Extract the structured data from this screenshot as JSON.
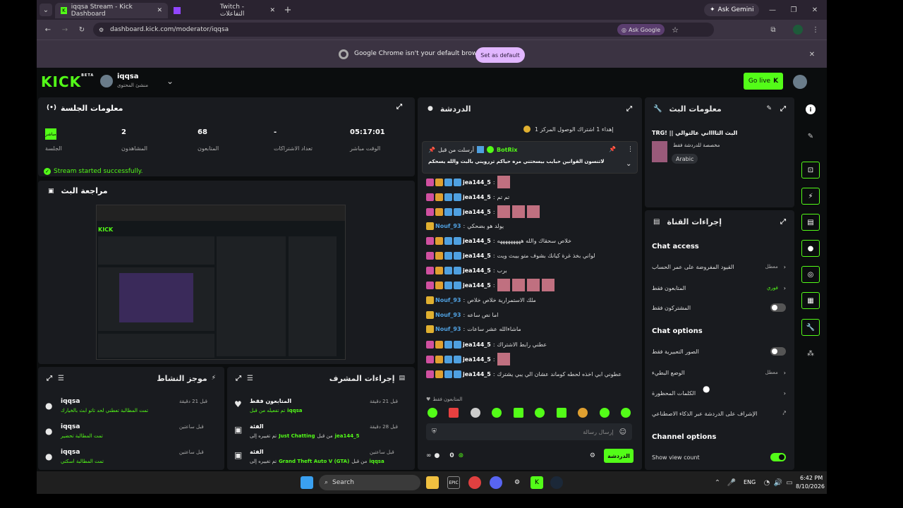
{
  "browser": {
    "tab1": "iqqsa Stream - Kick Dashboard",
    "tab2": "Twitch - التفاعلات",
    "ask_gemini": "Ask Gemini",
    "url": "dashboard.kick.com/moderator/iqqsa",
    "ask_google": "Ask Google"
  },
  "infobar": {
    "message": "Google Chrome isn't your default browser",
    "button": "Set as default"
  },
  "header": {
    "logo": "KICK",
    "beta": "BETA",
    "channel": "iqqsa",
    "role": "منشئ المحتوى",
    "go_live": "Go live"
  },
  "session": {
    "title": "معلومات الجلسة",
    "live": "مباشر",
    "session_label": "الجلسة",
    "viewers": "2",
    "viewers_label": "المشاهدون",
    "followers": "68",
    "followers_label": "المتابعون",
    "subs": "-",
    "subs_label": "تعداد الاشتراكات",
    "time": "05:17:01",
    "time_label": "الوقت مباشر",
    "status": "Stream started successfully."
  },
  "review": {
    "title": "مراجعة البث"
  },
  "activity": {
    "title": "موجز النشاط",
    "items": [
      {
        "user": "iqqsa",
        "time": "قبل 21 دقيقة",
        "text": "تمت المطالبة تعطني لحد تاتو ابث بالخيارك"
      },
      {
        "user": "iqqsa",
        "time": "قبل ساعتين",
        "text": "تمت المطالبة تحضير"
      },
      {
        "user": "iqqsa",
        "time": "قبل ساعتين",
        "text": "تمت المطالبة اسكتي"
      }
    ]
  },
  "modactions": {
    "title": "إجراءات المشرف",
    "items": [
      {
        "title": "المتابعون فقط",
        "time": "قبل 21 دقيقة",
        "text": "تم تفعيله من قبل",
        "user": "iqqsa"
      },
      {
        "title": "الفئة",
        "time": "قبل 28 دقيقة",
        "text": "تم تغييره إلى",
        "cat": "Just Chatting",
        "by": "من قبل",
        "user": "jea144_5"
      },
      {
        "title": "الفئة",
        "time": "قبل ساعتين",
        "text": "تم تغييره إلى",
        "cat": "Grand Theft Auto V (GTA)",
        "by": "من قبل",
        "user": "iqqsa"
      }
    ]
  },
  "chat": {
    "title": "الدردشة",
    "top_banner": "إهداء 1 اشتراك الوصول المركز 1",
    "pinned_by": "أرسلت من قبل",
    "pinned_user": "BotRix",
    "pinned_text": "لاتنسون القوانين حبايب بيسحتني مره حياكم تررويني بالبث والله يسحكم",
    "followers_only": "المتابعون فقط",
    "placeholder": "إرسال رسالة",
    "send": "الدردشة",
    "counter": "0",
    "lines": [
      {
        "user": "jea144_5",
        "text": ""
      },
      {
        "user": "jea144_5",
        "text": "تم تم"
      },
      {
        "user": "jea144_5",
        "text": ""
      },
      {
        "user": "Nouf_93",
        "text": "يولد هو بضحكي"
      },
      {
        "user": "jea144_5",
        "text": "خلاص سحقاك والله هههههههههه"
      },
      {
        "user": "jea144_5",
        "text": "لواني بخذ غرة كيانك بشوف متو بيبث ويت"
      },
      {
        "user": "jea144_5",
        "text": "برب"
      },
      {
        "user": "jea144_5",
        "text": ""
      },
      {
        "user": "Nouf_93",
        "text": "ملك الاستمرارية خلاص خلاص"
      },
      {
        "user": "Nouf_93",
        "text": "اما نص ساعه"
      },
      {
        "user": "Nouf_93",
        "text": "ماشاءالله عشر ساعات"
      },
      {
        "user": "jea144_5",
        "text": "عطني رابط الاشتراك"
      },
      {
        "user": "jea144_5",
        "text": ""
      },
      {
        "user": "jea144_5",
        "text": "عطوني ابي اخذه لحطه كوماند عشان الي يبي يشترك"
      }
    ]
  },
  "streaminfo": {
    "title": "معلومات البث",
    "stream_title": "TRG! || البث الثااااني عالتوالي",
    "category": "مخصصة للدردشة فقط",
    "language": "Arabic"
  },
  "channel": {
    "title": "إجراءات القناة",
    "chat_access": "Chat access",
    "r1": "القيود المفروضة على عمر الحساب",
    "r1v": "معطل",
    "r2": "المتابعون فقط",
    "r2v": "فوري",
    "r3": "المشتركون فقط",
    "chat_options": "Chat options",
    "r4": "الصور التعبيرية فقط",
    "r5": "الوضع البطيء",
    "r5v": "معطل",
    "r6": "الكلمات المحظورة",
    "r7": "الإشراف على الدردشة عبر الذكاء الاصطناعي",
    "channel_options": "Channel options",
    "r8": "Show view count"
  },
  "taskbar": {
    "search": "Search",
    "lang": "ENG",
    "time": "6:42 PM",
    "date": "8/10/2026"
  },
  "colors": {
    "accent": "#53fc18",
    "bg": "#0b0d0e",
    "panel": "#191b1f"
  }
}
